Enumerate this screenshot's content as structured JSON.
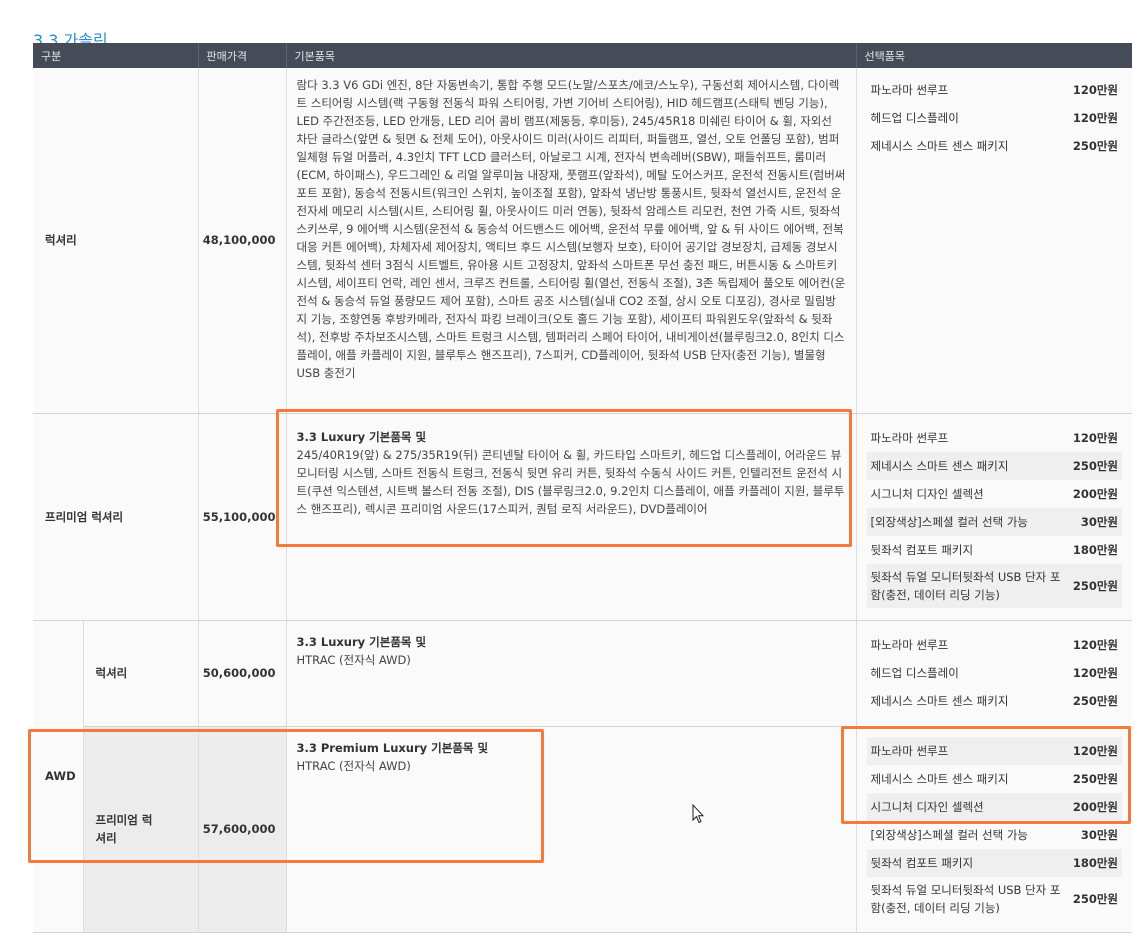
{
  "section_title": "3.3 가솔린",
  "headers": {
    "category": "구분",
    "price": "판매가격",
    "basic": "기본품목",
    "options": "선택품목"
  },
  "rows": [
    {
      "grade": "럭셔리",
      "price": "48,100,000",
      "basic_text": "람다 3.3 V6 GDi 엔진, 8단 자동변속기, 통합 주행 모드(노말/스포츠/에코/스노우), 구동선회 제어시스템, 다이렉트 스티어링 시스템(랙 구동형 전동식 파워 스티어링, 가변 기어비 스티어링), HID 헤드램프(스태틱 벤딩 기능), LED 주간전조등, LED 안개등, LED 리어 콤비 램프(제동등, 후미등), 245/45R18 미쉐린 타이어 & 휠, 자외선 차단 글라스(앞면 & 뒷면 & 전체 도어), 아웃사이드 미러(사이드 리피터, 퍼들램프, 열선, 오토 언폴딩 포함), 범퍼 일체형 듀얼 머플러, 4.3인치 TFT LCD 클러스터, 아날로그 시계, 전자식 변속레버(SBW), 패들쉬프트, 룸미러(ECM, 하이패스), 우드그레인 & 리얼 알루미늄 내장재, 풋램프(앞좌석), 메탈 도어스커프, 운전석 전동시트(럼버써포트 포함), 동승석 전동시트(워크인 스위치, 높이조절 포함), 앞좌석 냉난방 통풍시트, 뒷좌석 열선시트, 운전석 운전자세 메모리 시스템(시트, 스티어링 휠, 아웃사이드 미러 연동), 뒷좌석 암레스트 리모컨, 천연 가죽 시트, 뒷좌석 스키쓰루, 9 에어백 시스템(운전석 & 동승석 어드밴스드 에어백, 운전석 무릎 에어백, 앞 & 뒤 사이드 에어백, 전복 대응 커튼 에어백), 차체자세 제어장치, 액티브 후드 시스템(보행자 보호), 타이어 공기압 경보장치, 급제동 경보시스템, 뒷좌석 센터 3점식 시트벨트, 유아용 시트 고정장치, 앞좌석 스마트폰 무선 충전 패드, 버튼시동 & 스마트키 시스템, 세이프티 언락, 레인 센서, 크루즈 컨트롤, 스티어링 휠(열선, 전동식 조절), 3존 독립제어 풀오토 에어컨(운전석 & 동승석 듀얼 풍량모드 제어 포함), 스마트 공조 시스템(실내 CO2 조절, 상시 오토 디포깅), 경사로 밀림방지 기능, 조향연동 후방카메라, 전자식 파킹 브레이크(오토 홀드 기능 포함), 세이프티 파워윈도우(앞좌석 & 뒷좌석), 전후방 주차보조시스템, 스마트 트렁크 시스템, 템퍼러리 스페어 타이어, 내비게이션(블루링크2.0, 8인치 디스플레이, 애플 카플레이 지원, 블루투스 핸즈프리), 7스피커, CD플레이어, 뒷좌석 USB 단자(충전 기능), 별물형 USB 충전기",
      "options": [
        {
          "name": "파노라마 썬루프",
          "price": "120만원"
        },
        {
          "name": "헤드업 디스플레이",
          "price": "120만원"
        },
        {
          "name": "제네시스 스마트 센스 패키지",
          "price": "250만원"
        }
      ]
    },
    {
      "grade": "프리미엄 럭셔리",
      "price": "55,100,000",
      "basic_title": "3.3 Luxury 기본품목 및",
      "basic_text": "245/40R19(앞) & 275/35R19(뒤) 콘티넨탈 타이어 & 휠, 카드타입 스마트키, 헤드업 디스플레이, 어라운드 뷰 모니터링 시스템, 스마트 전동식 트렁크, 전동식 뒷면 유리 커튼, 뒷좌석 수동식 사이드 커튼, 인텔리전트 운전석 시트(쿠션 익스텐션, 시트백 볼스터 전동 조절), DIS (블루링크2.0, 9.2인치 디스플레이, 애플 카플레이 지원, 블루투스 핸즈프리), 렉시콘 프리미엄 사운드(17스피커, 퀀텀 로직 서라운드), DVD플레이어",
      "options": [
        {
          "name": "파노라마 썬루프",
          "price": "120만원"
        },
        {
          "name": "제네시스 스마트 센스 패키지",
          "price": "250만원"
        },
        {
          "name": "시그니처 디자인 셀렉션",
          "price": "200만원"
        },
        {
          "name": "[외장색상]스페셜 컬러 선택 가능",
          "price": "30만원"
        },
        {
          "name": "뒷좌석 컴포트 패키지",
          "price": "180만원"
        },
        {
          "name": "뒷좌석 듀얼 모니터뒷좌석 USB 단자 포함(충전, 데이터 리딩 기능)",
          "price": "250만원"
        }
      ]
    },
    {
      "group": "AWD",
      "grade": "럭셔리",
      "price": "50,600,000",
      "basic_title": "3.3 Luxury 기본품목 및",
      "basic_text": "HTRAC (전자식 AWD)",
      "options": [
        {
          "name": "파노라마 썬루프",
          "price": "120만원"
        },
        {
          "name": "헤드업 디스플레이",
          "price": "120만원"
        },
        {
          "name": "제네시스 스마트 센스 패키지",
          "price": "250만원"
        }
      ]
    },
    {
      "group": "AWD",
      "grade": "프리미엄 럭셔리",
      "price": "57,600,000",
      "basic_title": "3.3 Premium Luxury 기본품목 및",
      "basic_text": "HTRAC (전자식 AWD)",
      "options": [
        {
          "name": "파노라마 썬루프",
          "price": "120만원"
        },
        {
          "name": "제네시스 스마트 센스 패키지",
          "price": "250만원"
        },
        {
          "name": "시그니처 디자인 셀렉션",
          "price": "200만원"
        },
        {
          "name": "[외장색상]스페셜 컬러 선택 가능",
          "price": "30만원"
        },
        {
          "name": "뒷좌석 컴포트 패키지",
          "price": "180만원"
        },
        {
          "name": "뒷좌석 듀얼 모니터뒷좌석 USB 단자 포함(충전, 데이터 리딩 기능)",
          "price": "250만원"
        }
      ]
    }
  ],
  "colors": {
    "title": "#2a8ed3",
    "header_bg": "#454b57",
    "highlight": "#f47a3b"
  },
  "cursor_icon": "mouse-pointer-icon"
}
